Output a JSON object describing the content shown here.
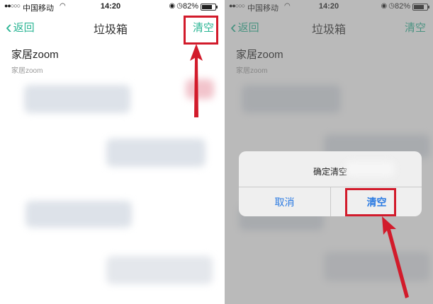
{
  "status_bar": {
    "signal": "●●○○○",
    "carrier": "中国移动",
    "time": "14:20",
    "battery": "82%",
    "battery_level": 0.82
  },
  "navbar": {
    "back_label": "返回",
    "title": "垃圾箱",
    "clear_label": "清空"
  },
  "trash_item": {
    "title": "家居zoom",
    "subtitle": "家居zoom"
  },
  "dialog": {
    "message": "确定清空",
    "cancel_label": "取消",
    "confirm_label": "清空"
  },
  "colors": {
    "accent": "#2bb594",
    "highlight": "#d21b2b",
    "dialog_button": "#2a7ae2"
  }
}
